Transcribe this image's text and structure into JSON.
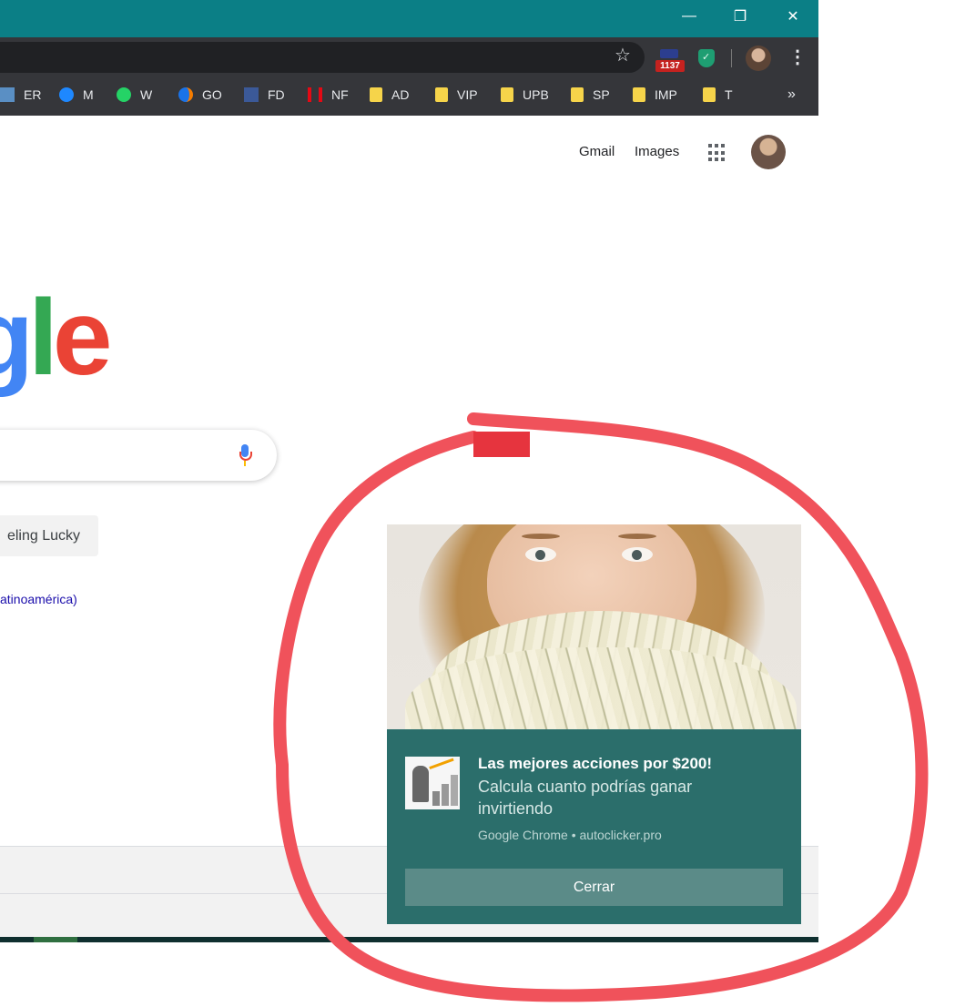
{
  "browser": {
    "window_controls": {
      "minimize": "—",
      "restore": "❐",
      "close": "✕"
    },
    "extension_badge": "1137",
    "bookmarks": [
      {
        "label": "ER",
        "icon": "chart-icon"
      },
      {
        "label": "M",
        "icon": "messenger-icon"
      },
      {
        "label": "W",
        "icon": "whatsapp-icon"
      },
      {
        "label": "GO",
        "icon": "go-icon"
      },
      {
        "label": "FD",
        "icon": "facebook-icon"
      },
      {
        "label": "NF",
        "icon": "netflix-icon"
      },
      {
        "label": "AD",
        "icon": "folder-icon"
      },
      {
        "label": "VIP",
        "icon": "folder-icon"
      },
      {
        "label": "UPB",
        "icon": "folder-icon"
      },
      {
        "label": "SP",
        "icon": "folder-icon"
      },
      {
        "label": "IMP",
        "icon": "folder-icon"
      },
      {
        "label": "T",
        "icon": "folder-icon"
      }
    ],
    "more_bookmarks": "»"
  },
  "google": {
    "gmail": "Gmail",
    "images": "Images",
    "logo_partial": {
      "g": "g",
      "l": "l",
      "e": "e"
    },
    "lucky_button": "eling Lucky",
    "language_link": "atinoamérica)"
  },
  "notification": {
    "title": "Las mejores acciones por $200!",
    "text": "Calcula cuanto podrías ganar invirtiendo",
    "source": "Google Chrome • autoclicker.pro",
    "close_button": "Cerrar"
  },
  "colors": {
    "titlebar": "#0b7f86",
    "notification_bg": "#2b6e6b",
    "annotation_circle": "#f0525b"
  }
}
